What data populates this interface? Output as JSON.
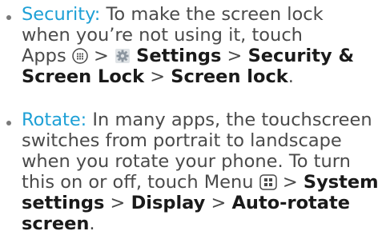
{
  "items": [
    {
      "term": "Security:",
      "line1_text": " To make the screen lock",
      "line2_text": "when you’re not using it, touch",
      "line3_apps": "Apps",
      "line3_sep1": " > ",
      "line3_settings": "Settings",
      "line3_sep2": " > ",
      "line3_security": "Security &",
      "line4_screen_lock_cat": "Screen Lock",
      "line4_sep": " > ",
      "line4_screen_lock": "Screen lock",
      "line4_end": "."
    },
    {
      "term": "Rotate:",
      "line1_text": " In many apps, the touchscreen",
      "line2_text": "switches from portrait to landscape",
      "line3_text": "when you rotate your phone. To turn",
      "line4_text": "this on or off, touch Menu ",
      "line4_sep": " > ",
      "line4_system": "System",
      "line5_settings": "settings",
      "line5_sep1": " > ",
      "line5_display": "Display",
      "line5_sep2": " > ",
      "line5_auto": "Auto-rotate",
      "line6_screen": "screen",
      "line6_end": "."
    }
  ],
  "icons": {
    "apps": "apps-grid-icon",
    "settings": "settings-gear-icon",
    "menu": "menu-icon"
  },
  "colors": {
    "term": "#1ea0d6",
    "body_text": "#4a4a4a",
    "bold_text": "#1a1a1a"
  }
}
